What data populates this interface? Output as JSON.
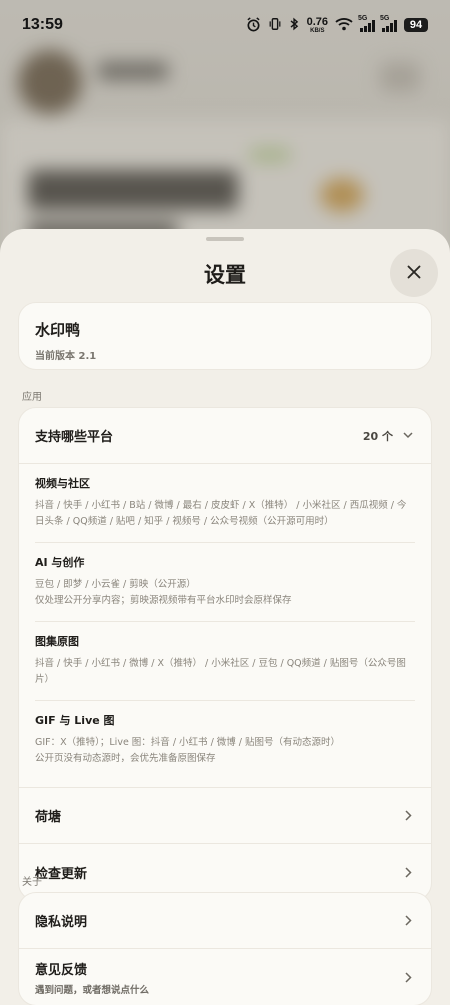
{
  "status": {
    "time": "13:59",
    "net_speed": "0.76",
    "net_unit": "KB/S",
    "sig1": "5G",
    "sig2": "5G",
    "battery": "94"
  },
  "sheet": {
    "title": "设置"
  },
  "app": {
    "name": "水印鸭",
    "version": "当前版本 2.1"
  },
  "sections": {
    "apps_label": "应用",
    "about_label": "关于"
  },
  "platforms": {
    "label": "支持哪些平台",
    "count": "20 个",
    "categories": [
      {
        "title": "视频与社区",
        "lines": [
          "抖音 / 快手 / 小红书 / B站 / 微博 / 最右 / 皮皮虾 / X（推特） / 小米社区 / 西瓜视频 / 今日头条 / QQ频道 / 贴吧 / 知乎 / 视频号 / 公众号视频（公开源可用时）"
        ]
      },
      {
        "title": "AI 与创作",
        "lines": [
          "豆包 / 即梦 / 小云雀 / 剪映（公开源）",
          "仅处理公开分享内容；剪映源视频带有平台水印时会原样保存"
        ]
      },
      {
        "title": "图集原图",
        "lines": [
          "抖音 / 快手 / 小红书 / 微博 / X（推特） / 小米社区 / 豆包 / QQ频道 / 贴图号（公众号图片）"
        ]
      },
      {
        "title": "GIF 与 Live 图",
        "lines": [
          "GIF：X（推特）；Live 图：抖音 / 小红书 / 微博 / 贴图号（有动态源时）",
          "公开页没有动态源时，会优先准备原图保存"
        ]
      }
    ],
    "items": [
      {
        "label": "荷塘"
      },
      {
        "label": "检查更新"
      }
    ]
  },
  "about": {
    "privacy": "隐私说明",
    "feedback": "意见反馈",
    "feedback_sub": "遇到问题，或者想说点什么"
  }
}
